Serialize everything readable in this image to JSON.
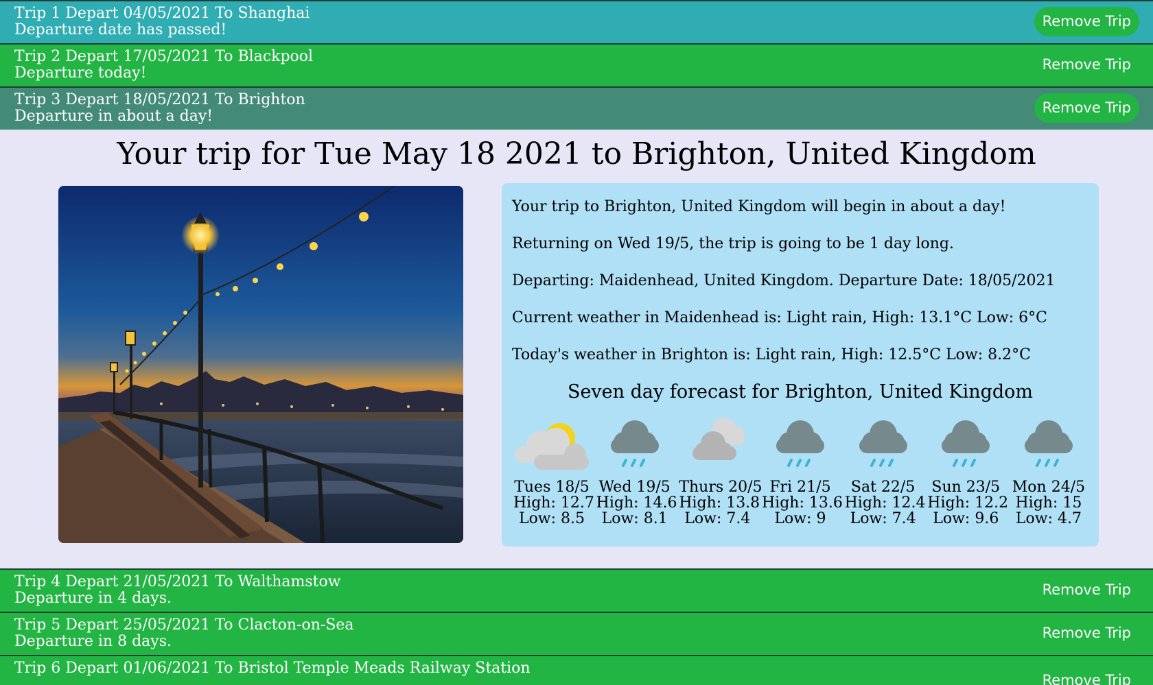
{
  "trips_before": [
    {
      "title": "Trip 1 Depart 04/05/2021 To Shanghai",
      "status": "Departure date has passed!",
      "button": "Remove Trip",
      "color": "#2fadb3",
      "button_style": "pill"
    },
    {
      "title": "Trip 2 Depart 17/05/2021 To Blackpool",
      "status": "Departure today!",
      "button": "Remove Trip",
      "color": "#22b543",
      "button_style": "plain"
    },
    {
      "title": "Trip 3 Depart 18/05/2021 To Brighton",
      "status": "Departure in about a day!",
      "button": "Remove Trip",
      "color": "#438b77",
      "button_style": "pill"
    }
  ],
  "detail": {
    "title": "Your trip for Tue May 18 2021 to Brighton, United Kingdom",
    "info": [
      "Your trip to Brighton, United Kingdom will begin in about a day!",
      "Returning on Wed 19/5, the trip is going to be 1 day long.",
      "Departing: Maidenhead, United Kingdom. Departure Date: 18/05/2021",
      "Current weather in Maidenhead is: Light rain, High: 13.1°C Low: 6°C",
      "Today's weather in Brighton is: Light rain, High: 12.5°C Low: 8.2°C"
    ],
    "forecast_title": "Seven day forecast for Brighton, United Kingdom",
    "forecast": [
      {
        "day": "Tues 18/5",
        "high": "High: 12.7",
        "low": "Low: 8.5",
        "icon": "partly-cloudy-icon"
      },
      {
        "day": "Wed 19/5",
        "high": "High: 14.6",
        "low": "Low: 8.1",
        "icon": "rain-icon"
      },
      {
        "day": "Thurs 20/5",
        "high": "High: 13.8",
        "low": "Low: 7.4",
        "icon": "cloudy-icon"
      },
      {
        "day": "Fri 21/5",
        "high": "High: 13.6",
        "low": "Low: 9",
        "icon": "rain-icon"
      },
      {
        "day": "Sat 22/5",
        "high": "High: 12.4",
        "low": "Low: 7.4",
        "icon": "rain-icon"
      },
      {
        "day": "Sun 23/5",
        "high": "High: 12.2",
        "low": "Low: 9.6",
        "icon": "rain-icon"
      },
      {
        "day": "Mon 24/5",
        "high": "High: 15",
        "low": "Low: 4.7",
        "icon": "rain-icon"
      }
    ]
  },
  "trips_after": [
    {
      "title": "Trip 4 Depart 21/05/2021 To Walthamstow",
      "status": "Departure in 4 days.",
      "button": "Remove Trip",
      "color": "#22b543",
      "button_style": "plain"
    },
    {
      "title": "Trip 5 Depart 25/05/2021 To Clacton-on-Sea",
      "status": "Departure in 8 days.",
      "button": "Remove Trip",
      "color": "#22b543",
      "button_style": "plain"
    },
    {
      "title": "Trip 6 Depart 01/06/2021 To Bristol Temple Meads Railway Station",
      "status": "",
      "button": "Remove Trip",
      "color": "#22b543",
      "button_style": "plain"
    }
  ]
}
